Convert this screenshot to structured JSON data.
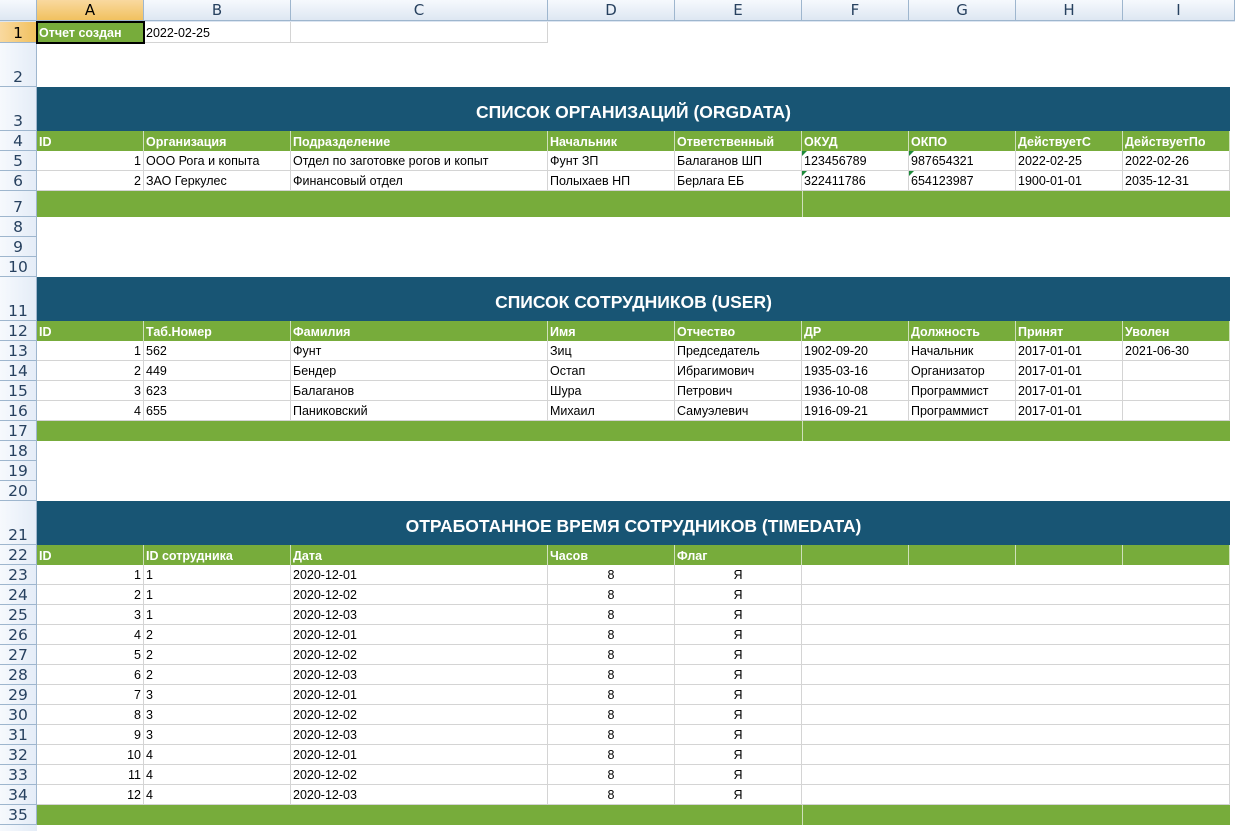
{
  "columns": [
    "A",
    "B",
    "C",
    "D",
    "E",
    "F",
    "G",
    "H",
    "I"
  ],
  "rows": [
    "1",
    "2",
    "3",
    "4",
    "5",
    "6",
    "7",
    "8",
    "9",
    "10",
    "11",
    "12",
    "13",
    "14",
    "15",
    "16",
    "17",
    "18",
    "19",
    "20",
    "21",
    "22",
    "23",
    "24",
    "25",
    "26",
    "27",
    "28",
    "29",
    "30",
    "31",
    "32",
    "33",
    "34",
    "35"
  ],
  "report": {
    "label": "Отчет создан",
    "value": "2022-02-25"
  },
  "orgdata": {
    "title": "СПИСОК ОРГАНИЗАЦИЙ (ORGDATA)",
    "headers": [
      "ID",
      "Организация",
      "Подразделение",
      "Начальник",
      "Ответственный",
      "ОКУД",
      "ОКПО",
      "ДействуетС",
      "ДействуетПо"
    ],
    "rows": [
      [
        "1",
        "ООО Рога и копыта",
        "Отдел по заготовке рогов и копыт",
        "Фунт ЗП",
        "Балаганов ШП",
        "123456789",
        "987654321",
        "2022-02-25",
        "2022-02-26"
      ],
      [
        "2",
        "ЗАО Геркулес",
        "Финансовый отдел",
        "Полыхаев НП",
        "Берлага ЕБ",
        "322411786",
        "654123987",
        "1900-01-01",
        "2035-12-31"
      ]
    ]
  },
  "users": {
    "title": "СПИСОК СОТРУДНИКОВ (USER)",
    "headers": [
      "ID",
      "Таб.Номер",
      "Фамилия",
      "Имя",
      "Отчество",
      "ДР",
      "Должность",
      "Принят",
      "Уволен"
    ],
    "rows": [
      [
        "1",
        "562",
        "Фунт",
        "Зиц",
        "Председатель",
        "1902-09-20",
        "Начальник",
        "2017-01-01",
        "2021-06-30"
      ],
      [
        "2",
        "449",
        "Бендер",
        "Остап",
        "Ибрагимович",
        "1935-03-16",
        "Организатор",
        "2017-01-01",
        ""
      ],
      [
        "3",
        "623",
        "Балаганов",
        "Шура",
        "Петрович",
        "1936-10-08",
        "Программист",
        "2017-01-01",
        ""
      ],
      [
        "4",
        "655",
        "Паниковский",
        "Михаил",
        "Самуэлевич",
        "1916-09-21",
        "Программист",
        "2017-01-01",
        ""
      ]
    ]
  },
  "timedata": {
    "title": "ОТРАБОТАННОЕ ВРЕМЯ СОТРУДНИКОВ (TIMEDATA)",
    "headers": [
      "ID",
      "ID сотрудника",
      "Дата",
      "Часов",
      "Флаг"
    ],
    "rows": [
      [
        "1",
        "1",
        "2020-12-01",
        "8",
        "Я"
      ],
      [
        "2",
        "1",
        "2020-12-02",
        "8",
        "Я"
      ],
      [
        "3",
        "1",
        "2020-12-03",
        "8",
        "Я"
      ],
      [
        "4",
        "2",
        "2020-12-01",
        "8",
        "Я"
      ],
      [
        "5",
        "2",
        "2020-12-02",
        "8",
        "Я"
      ],
      [
        "6",
        "2",
        "2020-12-03",
        "8",
        "Я"
      ],
      [
        "7",
        "3",
        "2020-12-01",
        "8",
        "Я"
      ],
      [
        "8",
        "3",
        "2020-12-02",
        "8",
        "Я"
      ],
      [
        "9",
        "3",
        "2020-12-03",
        "8",
        "Я"
      ],
      [
        "10",
        "4",
        "2020-12-01",
        "8",
        "Я"
      ],
      [
        "11",
        "4",
        "2020-12-02",
        "8",
        "Я"
      ],
      [
        "12",
        "4",
        "2020-12-03",
        "8",
        "Я"
      ]
    ]
  },
  "colors": {
    "title_bg": "#185574",
    "header_bg": "#77ac3b",
    "selection": "#f1c15f"
  }
}
